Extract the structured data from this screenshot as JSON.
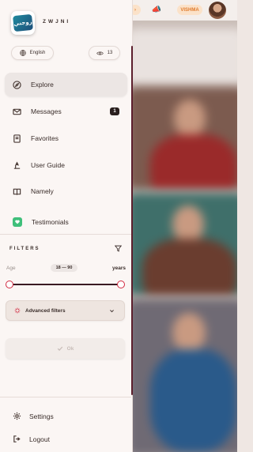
{
  "header": {
    "vip_label": "VISHMA",
    "megaphone_icon": "megaphone-icon"
  },
  "drawer": {
    "logo_text": "زوجني",
    "brand": "ZWJNI",
    "language": "English",
    "views_count": "13",
    "menu": [
      {
        "label": "Explore",
        "icon": "compass-icon",
        "active": true
      },
      {
        "label": "Messages",
        "icon": "mail-icon",
        "badge": "1"
      },
      {
        "label": "Favorites",
        "icon": "bookmark-icon"
      },
      {
        "label": "User Guide",
        "icon": "guide-icon"
      },
      {
        "label": "Namely",
        "icon": "book-icon"
      },
      {
        "label": "Testimonials",
        "icon": "heart-chat-icon"
      }
    ],
    "filters": {
      "title": "FILTERS",
      "age_label": "Age",
      "range_text": "18 — 90",
      "age_min": 18,
      "age_max": 90,
      "unit": "years",
      "advanced_label": "Advanced filters",
      "ok_label": "Ok"
    },
    "bottom": [
      {
        "label": "Settings",
        "icon": "gear-icon"
      },
      {
        "label": "Logout",
        "icon": "logout-icon"
      }
    ]
  },
  "colors": {
    "accent": "#d1283f",
    "track": "#3a1a22",
    "scrollbar": "#5c1f2d",
    "badge": "#2a1f1e"
  }
}
